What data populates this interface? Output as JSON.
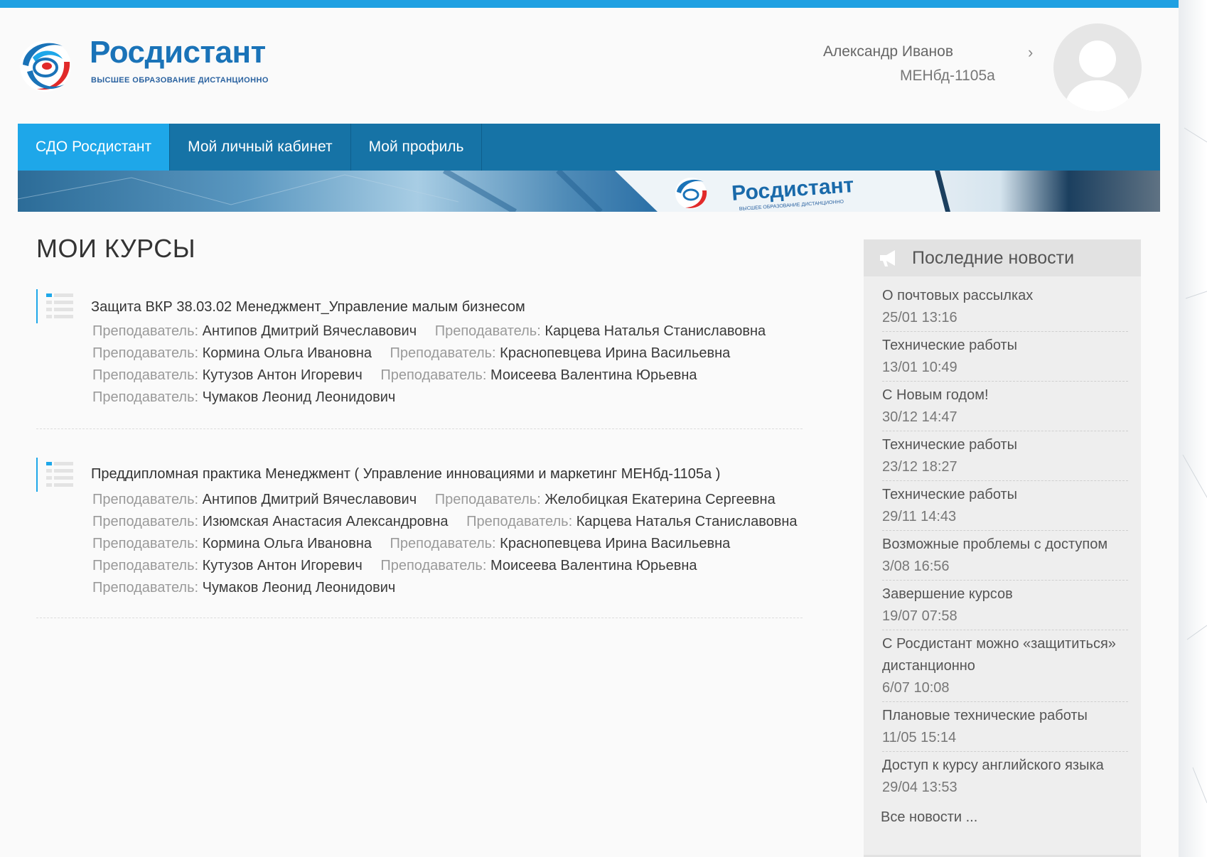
{
  "header": {
    "brand_name": "Росдистант",
    "brand_tagline": "ВЫСШЕЕ ОБРАЗОВАНИЕ ДИСТАНЦИОННО",
    "user_name": "Александр Иванов",
    "user_group": "МЕНбд-1105а"
  },
  "nav": {
    "items": [
      {
        "label": "СДО Росдистант",
        "active": true
      },
      {
        "label": "Мой личный кабинет"
      },
      {
        "label": "Мой профиль"
      }
    ]
  },
  "banner": {
    "brand_name": "Росдистант",
    "brand_tagline": "ВЫСШЕЕ ОБРАЗОВАНИЕ ДИСТАНЦИОННО"
  },
  "main": {
    "heading": "МОИ КУРСЫ",
    "teacher_label": "Преподаватель:",
    "courses": [
      {
        "title": "Защита ВКР 38.03.02 Менеджмент_Управление малым бизнесом",
        "teacher_lines": [
          [
            "Антипов Дмитрий Вячеславович",
            "Карцева Наталья Станиславовна"
          ],
          [
            "Кормина Ольга Ивановна",
            "Краснопевцева Ирина Васильевна"
          ],
          [
            "Кутузов Антон Игоревич",
            "Моисеева Валентина Юрьевна"
          ],
          [
            "Чумаков Леонид Леонидович"
          ]
        ]
      },
      {
        "title": "Преддипломная практика Менеджмент ( Управление инновациями и маркетинг МЕНбд-1105а )",
        "teacher_lines": [
          [
            "Антипов Дмитрий Вячеславович",
            "Желобицкая Екатерина Сергеевна"
          ],
          [
            "Изюмская Анастасия Александровна",
            "Карцева Наталья Станиславовна"
          ],
          [
            "Кормина Ольга Ивановна",
            "Краснопевцева Ирина Васильевна"
          ],
          [
            "Кутузов Антон Игоревич",
            "Моисеева Валентина Юрьевна"
          ],
          [
            "Чумаков Леонид Леонидович"
          ]
        ]
      }
    ]
  },
  "news": {
    "title": "Последние новости",
    "items": [
      {
        "title": "О почтовых рассылках",
        "date": "25/01 13:16"
      },
      {
        "title": "Технические работы",
        "date": "13/01 10:49"
      },
      {
        "title": "С Новым годом!",
        "date": "30/12 14:47"
      },
      {
        "title": "Технические работы",
        "date": "23/12 18:27"
      },
      {
        "title": "Технические работы",
        "date": "29/11 14:43"
      },
      {
        "title": "Возможные проблемы с доступом",
        "date": "3/08 16:56"
      },
      {
        "title": "Завершение курсов",
        "date": "19/07 07:58"
      },
      {
        "title": "С Росдистант можно «защититься» дистанционно",
        "date": "6/07 10:08"
      },
      {
        "title": "Плановые технические работы",
        "date": "11/05 15:14"
      },
      {
        "title": "Доступ к курсу английского языка",
        "date": "29/04 13:53"
      }
    ],
    "all_link": "Все новости ..."
  },
  "colors": {
    "accent": "#1ea7e9",
    "nav_bg": "#1673a6",
    "brand": "#1a73b8"
  }
}
